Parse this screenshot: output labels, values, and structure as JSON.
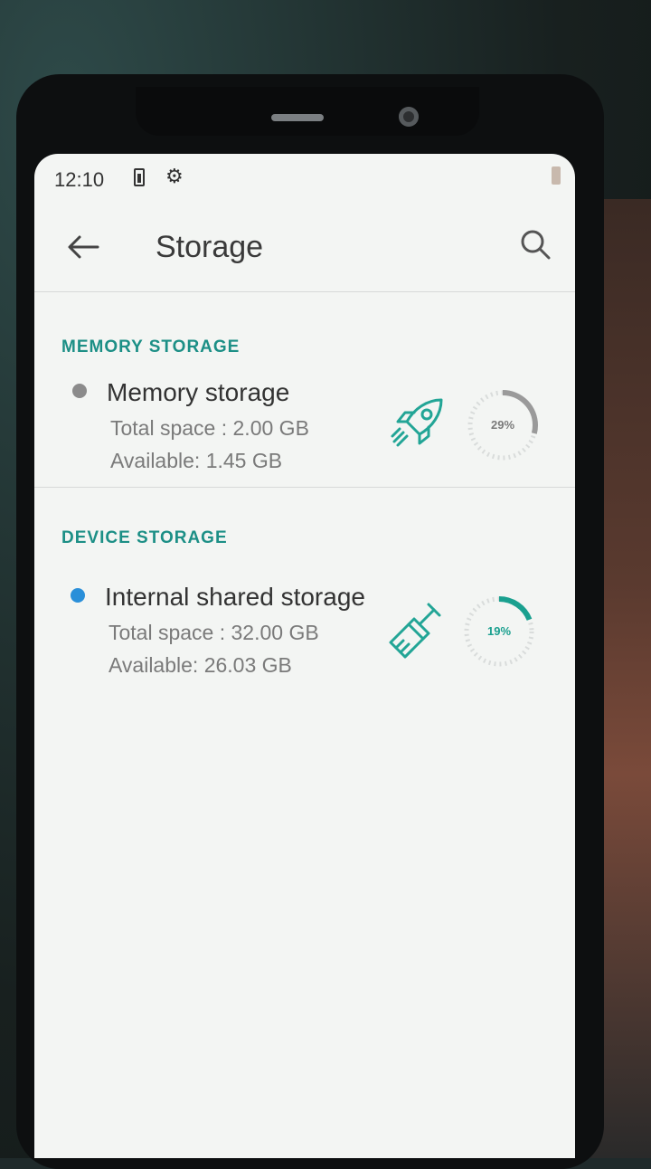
{
  "status_bar": {
    "time": "12:10"
  },
  "app_bar": {
    "title": "Storage"
  },
  "sections": [
    {
      "header": "MEMORY STORAGE",
      "item": {
        "title": "Memory storage",
        "total": "Total space : 2.00 GB",
        "available": "Available: 1.45 GB",
        "percent_label": "29%",
        "percent": 29,
        "dot_color": "#8b8b8b",
        "ring_color": "#9a9a9a",
        "icon": "rocket-icon"
      }
    },
    {
      "header": "DEVICE STORAGE",
      "item": {
        "title": "Internal shared storage",
        "total": "Total space : 32.00 GB",
        "available": "Available: 26.03 GB",
        "percent_label": "19%",
        "percent": 19,
        "dot_color": "#2a8fd9",
        "ring_color": "#1aa08f",
        "icon": "broom-icon"
      }
    }
  ],
  "colors": {
    "accent": "#1c8f86",
    "icon_green": "#22a596"
  }
}
